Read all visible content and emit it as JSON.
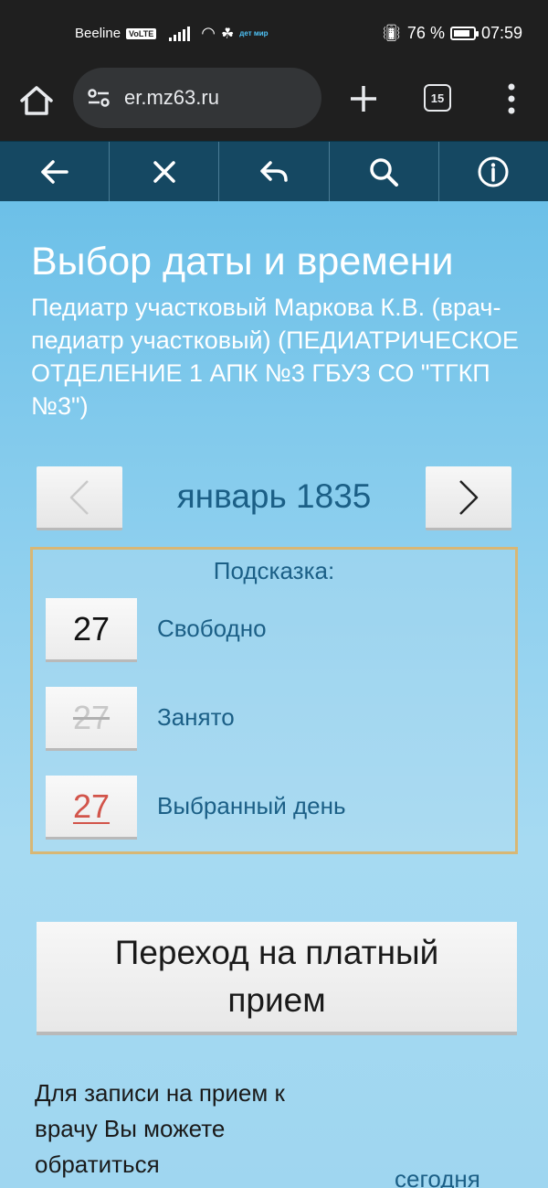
{
  "status_bar": {
    "carrier": "Beeline",
    "volte": "VoLTE",
    "detmir": "дет мир",
    "battery_percent": "76 %",
    "time": "07:59"
  },
  "browser": {
    "url": "er.mz63.ru",
    "tab_count": "15"
  },
  "toolbar": {
    "icons": [
      "back-arrow-icon",
      "close-icon",
      "undo-icon",
      "search-icon",
      "info-icon"
    ]
  },
  "page": {
    "title": "Выбор даты и времени",
    "doctor_info": "Педиатр участковый Маркова К.В. (врач-педиатр участковый) (ПЕДИАТРИЧЕСКОЕ ОТДЕЛЕНИЕ 1 АПК №3 ГБУЗ СО \"ТГКП №3\")",
    "month_label": "январь 1835",
    "hint": {
      "title": "Подсказка:",
      "free": {
        "day": "27",
        "label": "Свободно"
      },
      "busy": {
        "day": "27",
        "label": "Занято"
      },
      "selected": {
        "day": "27",
        "label": "Выбранный день"
      }
    },
    "paid_button": "Переход на платный прием",
    "bottom_text": "Для записи на прием к врачу Вы можете обратиться",
    "bottom_link": "сегодня"
  },
  "colors": {
    "toolbar_bg": "#154862",
    "content_bg": "#8dcfee",
    "link_blue": "#1b5f86",
    "hint_border": "#d8b775",
    "selected_day": "#d2544a"
  }
}
